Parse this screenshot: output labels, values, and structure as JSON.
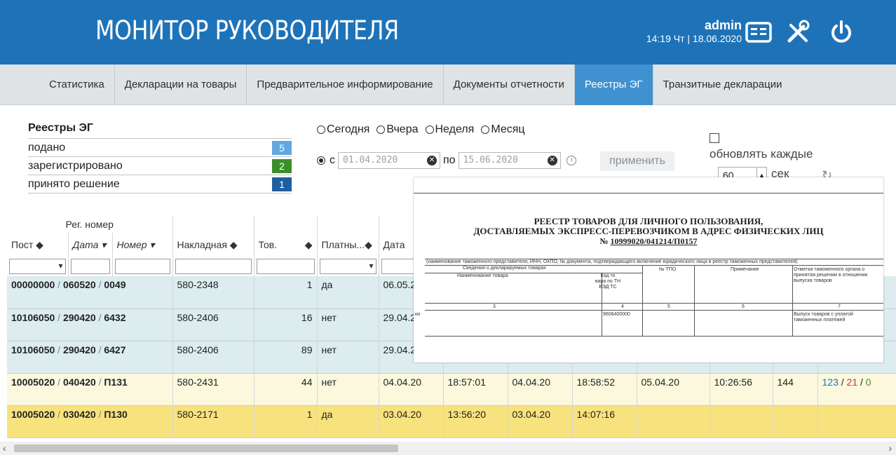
{
  "header": {
    "title": "МОНИТОР РУКОВОДИТЕЛЯ",
    "user": "admin",
    "datetime": "14:19 Чт | 18.06.2020",
    "icons": [
      "table-icon",
      "tools-icon",
      "power-icon"
    ],
    "bg_color": "#1e73b8"
  },
  "tabs": [
    {
      "label": "Статистика"
    },
    {
      "label": "Декларации на товары"
    },
    {
      "label": "Предварительное информирование"
    },
    {
      "label": "Документы отчетности"
    },
    {
      "label": "Реестры ЭГ",
      "active": true
    },
    {
      "label": "Транзитные декларации"
    }
  ],
  "stats": {
    "title": "Реестры ЭГ",
    "rows": [
      {
        "label": "подано",
        "value": "5",
        "color": "#62a8df"
      },
      {
        "label": "зарегистрировано",
        "value": "2",
        "color": "#3b8f2a"
      },
      {
        "label": "принято решение",
        "value": "1",
        "color": "#1e5fa0"
      }
    ]
  },
  "filters": {
    "periods": [
      "Сегодня",
      "Вчера",
      "Неделя",
      "Месяц"
    ],
    "from_label": "с",
    "to_label": "по",
    "date_from": "01.04.2020",
    "date_to": "15.06.2020",
    "apply_label": "применить",
    "refresh_label": "обновлять каждые",
    "refresh_value": "60",
    "refresh_unit": "сек"
  },
  "table": {
    "group_header": "Рег. номер",
    "columns": [
      "Пост",
      "Дата",
      "Номер",
      "Накладная",
      "Тов.",
      "Платны...",
      "Дата"
    ],
    "rows": [
      {
        "post": "00000000",
        "date": "060520",
        "num": "0049",
        "invoice": "580-2348",
        "goods": "1",
        "paid": "да",
        "d1": "06.05.2",
        "t1": "",
        "d2": "",
        "t2": "",
        "d3": "",
        "t3": "",
        "n": "",
        "c1": "",
        "c2": "",
        "c3": "",
        "style": "blue"
      },
      {
        "post": "10106050",
        "date": "290420",
        "num": "6432",
        "invoice": "580-2406",
        "goods": "16",
        "paid": "нет",
        "d1": "29.04.2",
        "t1": "",
        "d2": "",
        "t2": "",
        "d3": "",
        "t3": "",
        "n": "",
        "c1": "",
        "c2": "",
        "c3": "",
        "style": "blue"
      },
      {
        "post": "10106050",
        "date": "290420",
        "num": "6427",
        "invoice": "580-2406",
        "goods": "89",
        "paid": "нет",
        "d1": "29.04.2",
        "t1": "",
        "d2": "",
        "t2": "",
        "d3": "",
        "t3": "",
        "n": "",
        "c1": "",
        "c2": "",
        "c3": "",
        "style": "blue"
      },
      {
        "post": "10005020",
        "date": "040420",
        "num": "П131",
        "invoice": "580-2431",
        "goods": "44",
        "paid": "нет",
        "d1": "04.04.20",
        "t1": "18:57:01",
        "d2": "04.04.20",
        "t2": "18:58:52",
        "d3": "05.04.20",
        "t3": "10:26:56",
        "n": "144",
        "c1": "123",
        "c2": "21",
        "c3": "0",
        "style": "cream"
      },
      {
        "post": "10005020",
        "date": "030420",
        "num": "П130",
        "invoice": "580-2171",
        "goods": "1",
        "paid": "да",
        "d1": "03.04.20",
        "t1": "13:56:20",
        "d2": "03.04.20",
        "t2": "14:07:16",
        "d3": "",
        "t3": "",
        "n": "",
        "c1": "",
        "c2": "",
        "c3": "",
        "style": "yellow"
      }
    ],
    "right_edge_label": "з/"
  },
  "document": {
    "title_line1": "РЕЕСТР ТОВАРОВ ДЛЯ ЛИЧНОГО ПОЛЬЗОВАНИЯ,",
    "title_line2": "ДОСТАВЛЯЕМЫХ ЭКСПРЕСС-ПЕРЕВОЗЧИКОМ В АДРЕС ФИЗИЧЕСКИХ ЛИЦ",
    "number_prefix": "№ ",
    "number": "10999020/041214/П0157",
    "subtitle": "(наименование таможенного представителя, ИНН, ОКПО, № документа, подтверждающего включение юридического лица в реестр таможенных представителей)",
    "col_group": "Сведения о декларируемых товарах",
    "col_name": "Наименование товара",
    "col_code": "Код то вара по ТН ВЭД ТС",
    "col_tpo": "№ ТПО",
    "col_note": "Примечание",
    "col_mark": "Отметка таможенного органа о принятом решении в отношении выпуска товаров",
    "nums": [
      "3",
      "4",
      "5",
      "6",
      "7"
    ],
    "cell_name": "ки",
    "cell_code": "9608400000",
    "cell_mark": "Выпуск товаров с уплатой таможенных платежей"
  }
}
